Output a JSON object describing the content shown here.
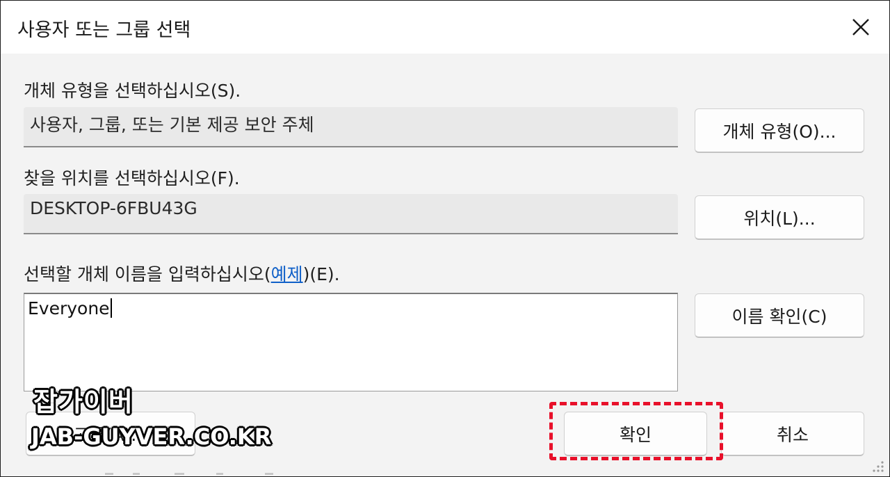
{
  "window": {
    "title": "사용자 또는 그룹 선택"
  },
  "object_type": {
    "label": "개체 유형을 선택하십시오(S).",
    "value": "사용자, 그룹, 또는 기본 제공 보안 주체",
    "button_label": "개체 유형(O)..."
  },
  "location": {
    "label": "찾을 위치를 선택하십시오(F).",
    "value": "DESKTOP-6FBU43G",
    "button_label": "위치(L)..."
  },
  "object_names": {
    "label_prefix": "선택할 개체 이름을 입력하십시오(",
    "label_link": "예제",
    "label_suffix": ")(E).",
    "value": "Everyone",
    "check_names_label": "이름 확인(C)"
  },
  "footer": {
    "advanced_label": "고급(A)...",
    "ok_label": "확인",
    "cancel_label": "취소"
  },
  "watermark": {
    "korean": "잡가이버",
    "url": "JAB-GUYVER.CO.KR"
  },
  "colors": {
    "highlight": "#e8102a",
    "link": "#1060c8"
  },
  "icons": {
    "close": "close-icon",
    "resize_grip": "resize-grip-icon"
  }
}
